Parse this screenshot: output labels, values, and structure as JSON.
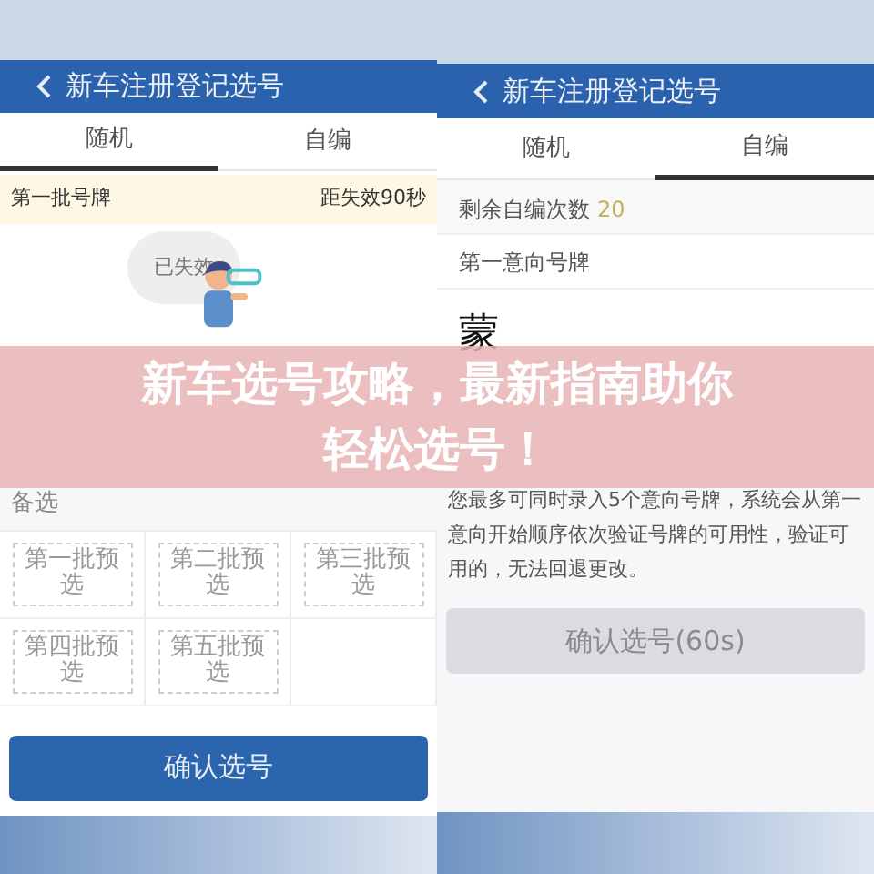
{
  "screens": [
    {
      "title": "新车注册登记选号",
      "tabs": [
        {
          "label": "随机",
          "selected": true
        },
        {
          "label": "自编",
          "selected": false
        }
      ],
      "batch_bar": {
        "label": "第一批号牌",
        "countdown": "距失效90秒"
      },
      "illustration": {
        "bubble": "已失效"
      },
      "alternates": {
        "label": "备选",
        "options": [
          "第一批预选",
          "第二批预选",
          "第三批预选",
          "第四批预选",
          "第五批预选"
        ]
      },
      "confirm_button": {
        "label": "确认选号",
        "disabled": false
      }
    },
    {
      "title": "新车注册登记选号",
      "tabs": [
        {
          "label": "随机",
          "selected": false
        },
        {
          "label": "自编",
          "selected": true
        }
      ],
      "remaining": {
        "label": "剩余自编次数",
        "count": "20"
      },
      "plate_label": "第一意向号牌",
      "plate_prefix": "蒙",
      "note": "您最多可同时录入5个意向号牌，系统会从第一意向开始顺序依次验证号牌的可用性，验证可用的，无法回退更改。",
      "confirm_button": {
        "label": "确认选号(60s)",
        "disabled": true
      }
    }
  ],
  "banner": {
    "lines": [
      "新车选号攻略，最新指南助你",
      "轻松选号！"
    ]
  }
}
